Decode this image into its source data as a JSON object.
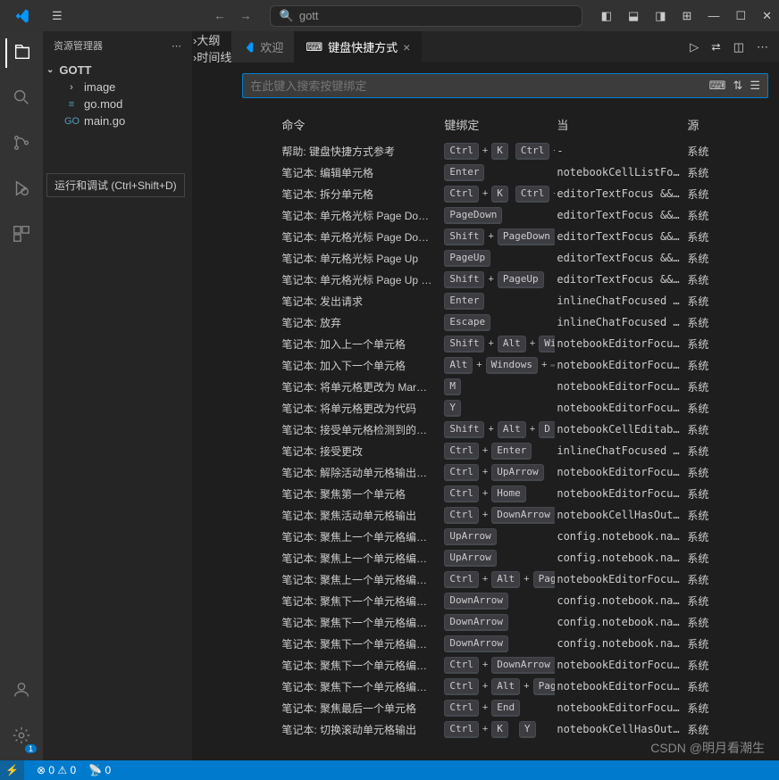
{
  "titlebar": {
    "search_prefix": "gott"
  },
  "sidebar": {
    "title": "资源管理器",
    "root": "GOTT",
    "items": [
      {
        "icon": "›",
        "label": "image",
        "type": "folder"
      },
      {
        "icon": "≡",
        "label": "go.mod",
        "color": "#519aba"
      },
      {
        "icon": "GO",
        "label": "main.go",
        "color": "#519aba"
      }
    ],
    "sections": [
      "大纲",
      "时间线"
    ]
  },
  "tabs": {
    "welcome": "欢迎",
    "keybindings": "键盘快捷方式"
  },
  "tooltip": "运行和调试 (Ctrl+Shift+D)",
  "search": {
    "placeholder": "在此键入搜索按键绑定"
  },
  "headers": {
    "command": "命令",
    "binding": "键绑定",
    "when": "当",
    "source": "源"
  },
  "rows": [
    {
      "cmd": "帮助: 键盘快捷方式参考",
      "keys": [
        [
          "Ctrl",
          "K"
        ],
        [
          "Ctrl",
          ""
        ]
      ],
      "when": "-",
      "src": "系统"
    },
    {
      "cmd": "笔记本: 编辑单元格",
      "keys": [
        [
          "Enter"
        ]
      ],
      "when": "notebookCellListFocus…",
      "src": "系统"
    },
    {
      "cmd": "笔记本: 拆分单元格",
      "keys": [
        [
          "Ctrl",
          "K"
        ],
        [
          "Ctrl",
          ""
        ]
      ],
      "when": "editorTextFocus && no…",
      "src": "系统"
    },
    {
      "cmd": "笔记本: 单元格光标 Page Do…",
      "keys": [
        [
          "PageDown"
        ]
      ],
      "when": "editorTextFocus && in…",
      "src": "系统"
    },
    {
      "cmd": "笔记本: 单元格光标 Page Do…",
      "keys": [
        [
          "Shift",
          "PageDown"
        ]
      ],
      "when": "editorTextFocus && in…",
      "src": "系统"
    },
    {
      "cmd": "笔记本: 单元格光标 Page Up",
      "keys": [
        [
          "PageUp"
        ]
      ],
      "when": "editorTextFocus && in…",
      "src": "系统"
    },
    {
      "cmd": "笔记本: 单元格光标 Page Up …",
      "keys": [
        [
          "Shift",
          "PageUp"
        ]
      ],
      "when": "editorTextFocus && in…",
      "src": "系统"
    },
    {
      "cmd": "笔记本: 发出请求",
      "keys": [
        [
          "Enter"
        ]
      ],
      "when": "inlineChatFocused && …",
      "src": "系统"
    },
    {
      "cmd": "笔记本: 放弃",
      "keys": [
        [
          "Escape"
        ]
      ],
      "when": "inlineChatFocused && …",
      "src": "系统"
    },
    {
      "cmd": "笔记本: 加入上一个单元格",
      "keys": [
        [
          "Shift",
          "Alt",
          "Wind"
        ]
      ],
      "when": "notebookEditorFocused",
      "src": "系统"
    },
    {
      "cmd": "笔记本: 加入下一个单元格",
      "keys": [
        [
          "Alt",
          "Windows",
          ""
        ]
      ],
      "when": "notebookEditorFocused",
      "src": "系统"
    },
    {
      "cmd": "笔记本: 将单元格更改为 Mar…",
      "keys": [
        [
          "M"
        ]
      ],
      "when": "notebookEditorFocused…",
      "src": "系统"
    },
    {
      "cmd": "笔记本: 将单元格更改为代码",
      "keys": [
        [
          "Y"
        ]
      ],
      "when": "notebookEditorFocused…",
      "src": "系统"
    },
    {
      "cmd": "笔记本: 接受单元格检测到的…",
      "keys": [
        [
          "Shift",
          "Alt",
          "D"
        ]
      ],
      "when": "notebookCellEditable …",
      "src": "系统"
    },
    {
      "cmd": "笔记本: 接受更改",
      "keys": [
        [
          "Ctrl",
          "Enter"
        ]
      ],
      "when": "inlineChatFocused && …",
      "src": "系统"
    },
    {
      "cmd": "笔记本: 解除活动单元格输出…",
      "keys": [
        [
          "Ctrl",
          "UpArrow"
        ]
      ],
      "when": "notebookEditorFocused…",
      "src": "系统"
    },
    {
      "cmd": "笔记本: 聚焦第一个单元格",
      "keys": [
        [
          "Ctrl",
          "Home"
        ]
      ],
      "when": "notebookEditorFocused…",
      "src": "系统"
    },
    {
      "cmd": "笔记本: 聚焦活动单元格输出",
      "keys": [
        [
          "Ctrl",
          "DownArrow"
        ]
      ],
      "when": "notebookCellHasOutput…",
      "src": "系统"
    },
    {
      "cmd": "笔记本: 聚焦上一个单元格编…",
      "keys": [
        [
          "UpArrow"
        ]
      ],
      "when": "config.notebook.navig…",
      "src": "系统"
    },
    {
      "cmd": "笔记本: 聚焦上一个单元格编…",
      "keys": [
        [
          "UpArrow"
        ]
      ],
      "when": "config.notebook.navig…",
      "src": "系统"
    },
    {
      "cmd": "笔记本: 聚焦上一个单元格编…",
      "keys": [
        [
          "Ctrl",
          "Alt",
          "PageU"
        ]
      ],
      "when": "notebookEditorFocused…",
      "src": "系统"
    },
    {
      "cmd": "笔记本: 聚焦下一个单元格编…",
      "keys": [
        [
          "DownArrow"
        ]
      ],
      "when": "config.notebook.navig…",
      "src": "系统"
    },
    {
      "cmd": "笔记本: 聚焦下一个单元格编…",
      "keys": [
        [
          "DownArrow"
        ]
      ],
      "when": "config.notebook.navig…",
      "src": "系统"
    },
    {
      "cmd": "笔记本: 聚焦下一个单元格编…",
      "keys": [
        [
          "DownArrow"
        ]
      ],
      "when": "config.notebook.navig…",
      "src": "系统"
    },
    {
      "cmd": "笔记本: 聚焦下一个单元格编…",
      "keys": [
        [
          "Ctrl",
          "DownArrow"
        ]
      ],
      "when": "notebookEditorFocused…",
      "src": "系统"
    },
    {
      "cmd": "笔记本: 聚焦下一个单元格编…",
      "keys": [
        [
          "Ctrl",
          "Alt",
          "PageD"
        ]
      ],
      "when": "notebookEditorFocused",
      "src": "系统"
    },
    {
      "cmd": "笔记本: 聚焦最后一个单元格",
      "keys": [
        [
          "Ctrl",
          "End"
        ]
      ],
      "when": "notebookEditorFocused…",
      "src": "系统"
    },
    {
      "cmd": "笔记本: 切换滚动单元格输出",
      "keys": [
        [
          "Ctrl",
          "K"
        ],
        [
          "Y"
        ]
      ],
      "when": "notebookCellHasOutput…",
      "src": "系统"
    }
  ],
  "status": {
    "errors": "0",
    "warnings": "0",
    "port": "0"
  },
  "watermark": "CSDN @明月看潮生"
}
